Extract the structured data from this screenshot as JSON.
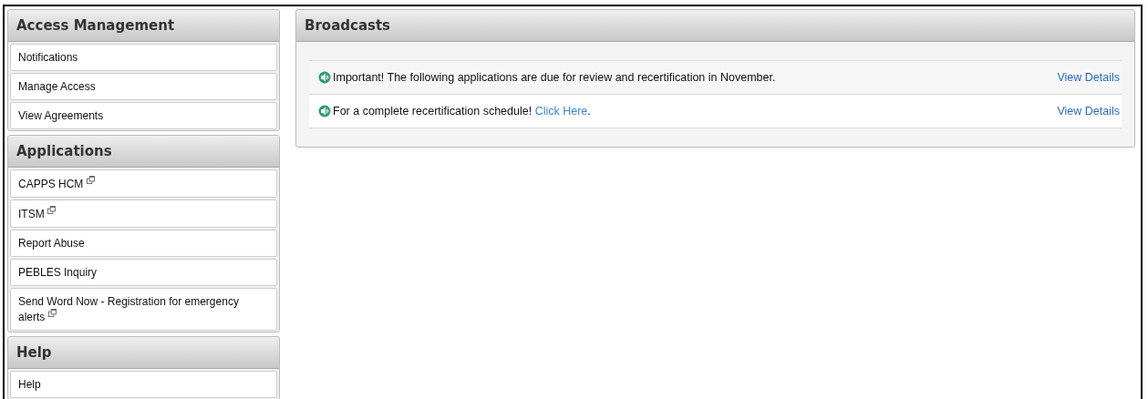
{
  "sidebar": {
    "sections": [
      {
        "title": "Access Management",
        "items": [
          {
            "label": "Notifications",
            "external": false
          },
          {
            "label": "Manage Access",
            "external": false
          },
          {
            "label": "View Agreements",
            "external": false
          }
        ]
      },
      {
        "title": "Applications",
        "items": [
          {
            "label": "CAPPS HCM",
            "external": true
          },
          {
            "label": "ITSM",
            "external": true
          },
          {
            "label": "Report Abuse",
            "external": false
          },
          {
            "label": "PEBLES Inquiry",
            "external": false
          },
          {
            "label": "Send Word Now - Registration for emergency alerts",
            "external": true
          }
        ]
      },
      {
        "title": "Help",
        "items": [
          {
            "label": "Help",
            "external": false
          }
        ]
      }
    ]
  },
  "broadcasts": {
    "title": "Broadcasts",
    "items": [
      {
        "text": "Important! The following applications are due for review and recertification in November.",
        "action": "View Details"
      },
      {
        "text": "For a complete recertification schedule!",
        "link": "Click Here",
        "after": ".",
        "action": "View Details"
      }
    ]
  }
}
